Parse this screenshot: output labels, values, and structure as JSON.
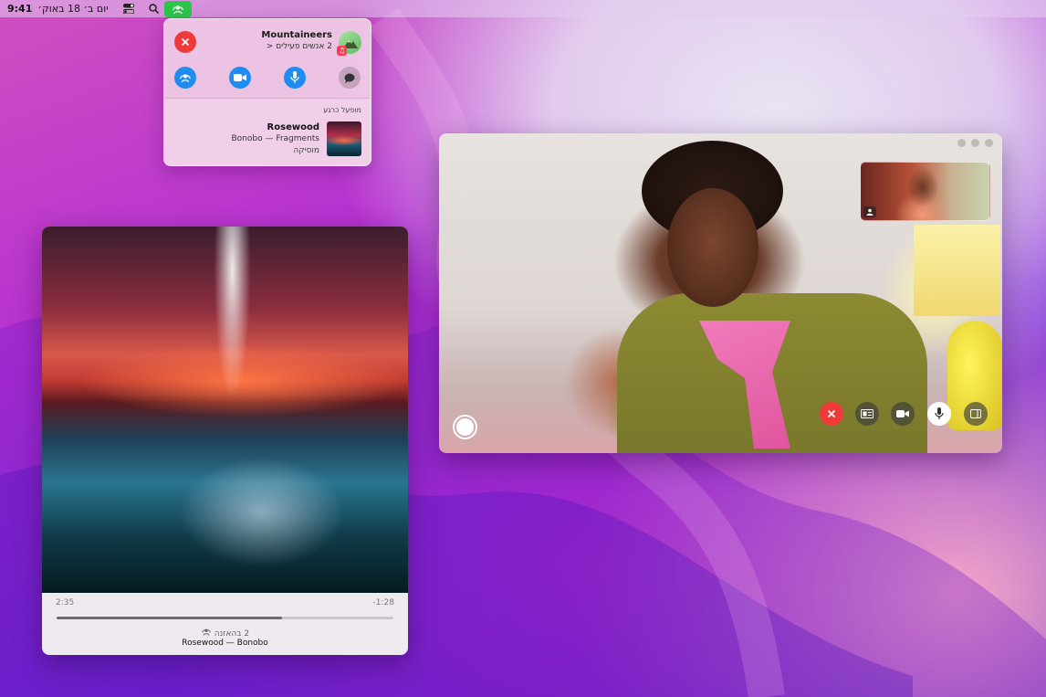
{
  "menubar": {
    "time": "9:41",
    "date": "יום ב׳ 18 באוק׳",
    "icons": [
      "control-center-icon",
      "search-icon",
      "wifi-icon",
      "shareplay-icon"
    ]
  },
  "shareplay_popover": {
    "group_name": "Mountaineers",
    "active_people": "2 אנשים פעילים",
    "chevron": "<",
    "section_label": "מופעל כרגע",
    "song_title": "Rosewood",
    "song_artist": "Bonobo — Fragments",
    "song_app": "מוסיקה",
    "buttons": [
      "close-icon",
      "shareplay-icon",
      "video-icon",
      "microphone-icon",
      "message-icon"
    ]
  },
  "music_window": {
    "elapsed": "2:35",
    "remaining": "-1:28",
    "progress": 0.67,
    "listeners": "2 בהאזנה",
    "now_playing": "Rosewood — Bonobo"
  },
  "facetime_window": {
    "controls": [
      "end-call-icon",
      "screen-share-icon",
      "video-icon",
      "microphone-icon",
      "sidebar-icon"
    ]
  },
  "colors": {
    "accent_blue": "#1f8cf2",
    "shareplay_green": "#2bc64a",
    "end_red": "#f03a3a"
  }
}
